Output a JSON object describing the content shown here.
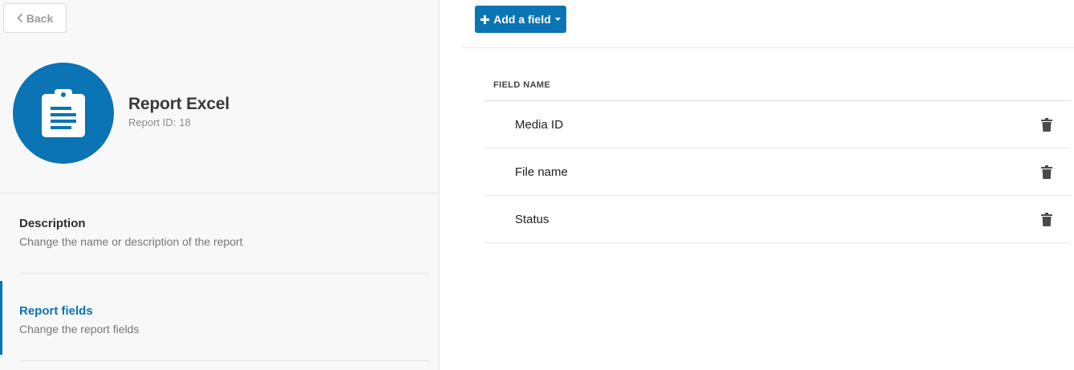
{
  "nav": {
    "back_label": "Back"
  },
  "report": {
    "title": "Report Excel",
    "id_label": "Report ID:",
    "id_value": "18",
    "icon": "clipboard-list-icon"
  },
  "sections": [
    {
      "title": "Description",
      "description": "Change the name or description of the report",
      "active": false
    },
    {
      "title": "Report fields",
      "description": "Change the report fields",
      "active": true
    }
  ],
  "toolbar": {
    "add_field_label": "Add a field"
  },
  "table": {
    "column_header": "FIELD NAME",
    "rows": [
      {
        "name": "Media ID"
      },
      {
        "name": "File name"
      },
      {
        "name": "Status"
      }
    ]
  },
  "colors": {
    "accent": "#0a74b4",
    "icon_gray": "#4a4a4a"
  }
}
